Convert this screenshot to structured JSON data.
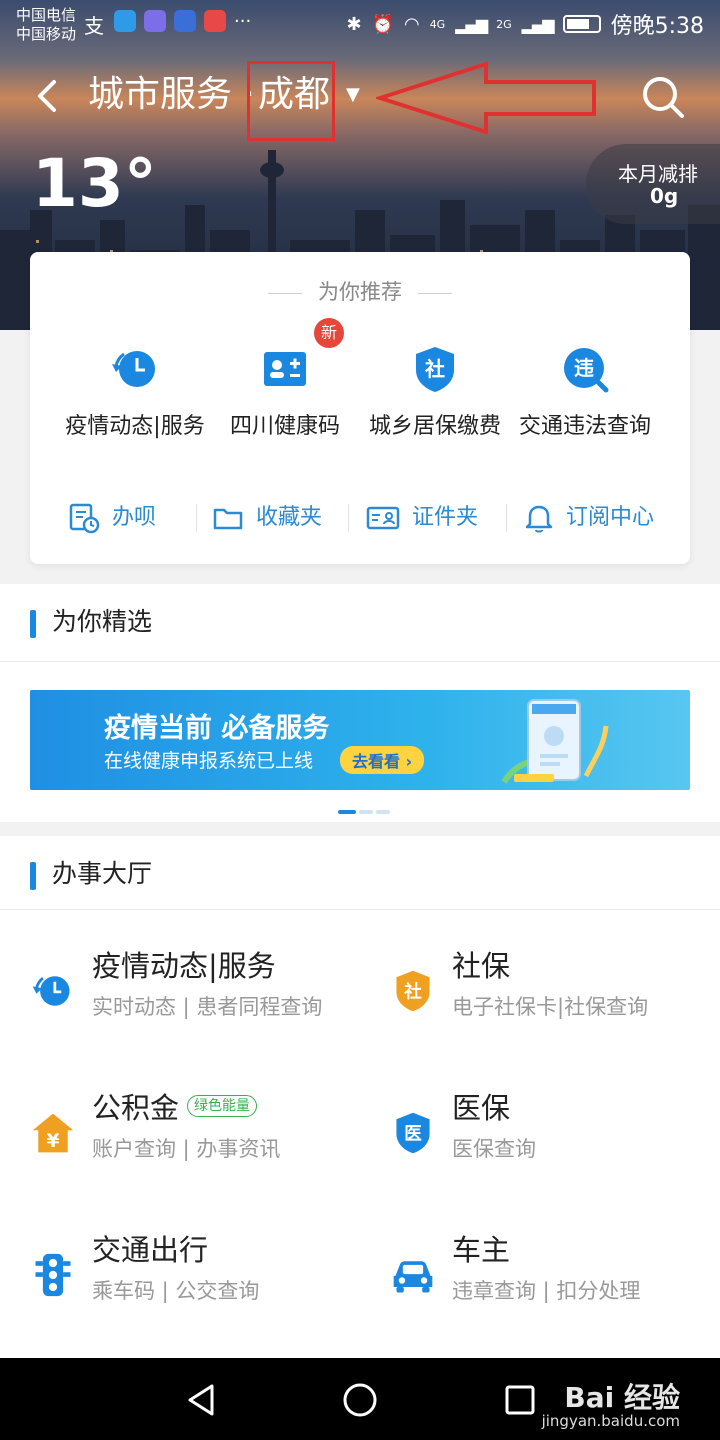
{
  "status_bar": {
    "carrier_1": "中国电信",
    "carrier_2": "中国移动",
    "network_1": "4G",
    "network_2": "2G",
    "time": "傍晚5:38"
  },
  "header": {
    "title": "城市服务 ·",
    "city": "成都",
    "temperature": "13°",
    "emission_label": "本月减排",
    "emission_value": "0g"
  },
  "recommend": {
    "title": "为你推荐",
    "new_badge": "新",
    "items": [
      {
        "label": "疫情动态|服务",
        "icon": "clock-refresh-icon"
      },
      {
        "label": "四川健康码",
        "icon": "health-card-icon"
      },
      {
        "label": "城乡居保缴费",
        "icon": "shield-she-icon"
      },
      {
        "label": "交通违法查询",
        "icon": "violation-search-icon"
      }
    ],
    "quick_links": [
      {
        "label": "办呗",
        "icon": "document-clock-icon"
      },
      {
        "label": "收藏夹",
        "icon": "folder-icon"
      },
      {
        "label": "证件夹",
        "icon": "id-card-icon"
      },
      {
        "label": "订阅中心",
        "icon": "bell-icon"
      }
    ]
  },
  "featured": {
    "title": "为你精选",
    "banner_title": "疫情当前 必备服务",
    "banner_subtitle": "在线健康申报系统已上线",
    "banner_button": "去看看 ›"
  },
  "hall": {
    "title": "办事大厅",
    "services": [
      {
        "name": "疫情动态|服务",
        "sub": "实时动态 | 患者同程查询",
        "icon": "clock-refresh-icon",
        "tag": ""
      },
      {
        "name": "社保",
        "sub": "电子社保卡|社保查询",
        "icon": "shield-she-icon",
        "tag": ""
      },
      {
        "name": "公积金",
        "sub": "账户查询 | 办事资讯",
        "icon": "house-yen-icon",
        "tag": "绿色能量"
      },
      {
        "name": "医保",
        "sub": "医保查询",
        "icon": "shield-yi-icon",
        "tag": ""
      },
      {
        "name": "交通出行",
        "sub": "乘车码 | 公交查询",
        "icon": "traffic-light-icon",
        "tag": ""
      },
      {
        "name": "车主",
        "sub": "违章查询 | 扣分处理",
        "icon": "car-icon",
        "tag": ""
      }
    ]
  },
  "watermark": {
    "brand": "Bai 经验",
    "url": "jingyan.baidu.com"
  },
  "colors": {
    "accent_blue": "#1a87e0",
    "annotation_red": "#e03131",
    "orange_icon": "#f0a020"
  }
}
